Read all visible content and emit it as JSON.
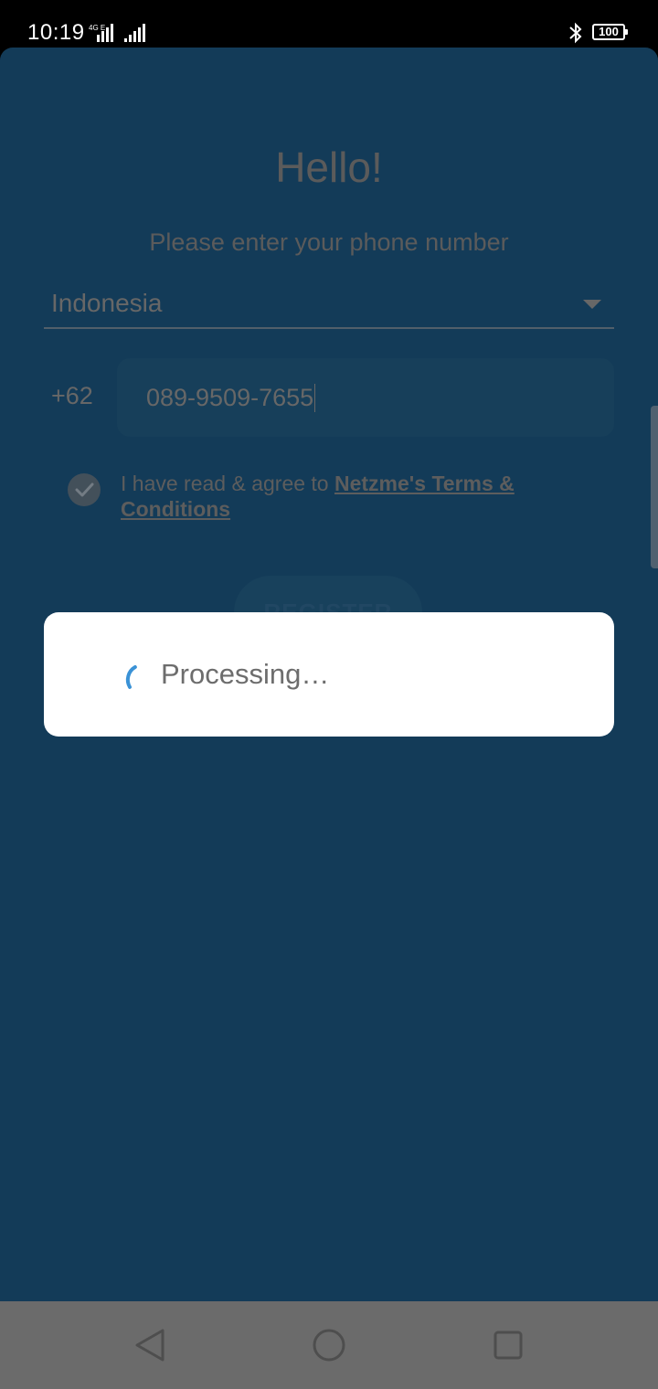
{
  "status_bar": {
    "time": "10:19",
    "battery": "100"
  },
  "main": {
    "title": "Hello!",
    "subtitle": "Please enter your phone number",
    "country_select": {
      "value": "Indonesia"
    },
    "phone": {
      "prefix": "+62",
      "value": "089-9509-7655"
    },
    "agreement": {
      "text": "I have read & agree to ",
      "link": "Netzme's Terms & Conditions",
      "checked": true
    },
    "register_button": "REGISTER"
  },
  "dialog": {
    "message": "Processing…",
    "accent_color": "#3a92d6"
  },
  "colors": {
    "background": "#1a4f76",
    "text_dimmed": "#7a7a7a"
  },
  "icons": {
    "dropdown": "chevron-down-icon",
    "check": "check-icon",
    "spinner": "spinner-icon",
    "nav_back": "back-icon",
    "nav_home": "home-icon",
    "nav_recents": "recents-icon",
    "bluetooth": "bluetooth-icon"
  }
}
